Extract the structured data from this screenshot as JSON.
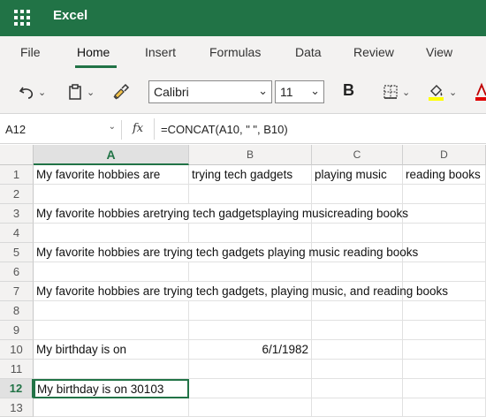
{
  "app": {
    "title": "Excel"
  },
  "tabs": [
    {
      "label": "File"
    },
    {
      "label": "Home"
    },
    {
      "label": "Insert"
    },
    {
      "label": "Formulas"
    },
    {
      "label": "Data"
    },
    {
      "label": "Review"
    },
    {
      "label": "View"
    }
  ],
  "active_tab": "Home",
  "toolbar": {
    "font_name": "Calibri",
    "font_size": "11",
    "bold_label": "B",
    "icons": [
      "undo-icon",
      "paste-icon",
      "format-painter-icon",
      "borders-icon",
      "fill-color-icon",
      "font-color-icon"
    ]
  },
  "formula_bar": {
    "name_box": "A12",
    "fx_label": "fx",
    "formula": "=CONCAT(A10, \" \", B10)"
  },
  "sheet": {
    "columns": [
      "A",
      "B",
      "C",
      "D"
    ],
    "rows": [
      "1",
      "2",
      "3",
      "4",
      "5",
      "6",
      "7",
      "8",
      "9",
      "10",
      "11",
      "12",
      "13"
    ],
    "selected_cell": "A12",
    "cells": {
      "A1": "My favorite hobbies are",
      "B1": "trying tech gadgets",
      "C1": "playing music",
      "D1": "reading books",
      "A3": "My favorite hobbies aretrying tech gadgetsplaying musicreading books",
      "A5": "My favorite hobbies are trying tech gadgets playing music reading books",
      "A7": "My favorite hobbies are trying tech gadgets, playing music, and reading books",
      "A10": "My birthday is on",
      "B10": "6/1/1982",
      "A12": "My birthday is on 30103"
    }
  },
  "colors": {
    "brand": "#217346",
    "ribbon_bg": "#f3f2f1",
    "fill_underline": "#ffff00",
    "font_color_underline": "#e00000"
  }
}
